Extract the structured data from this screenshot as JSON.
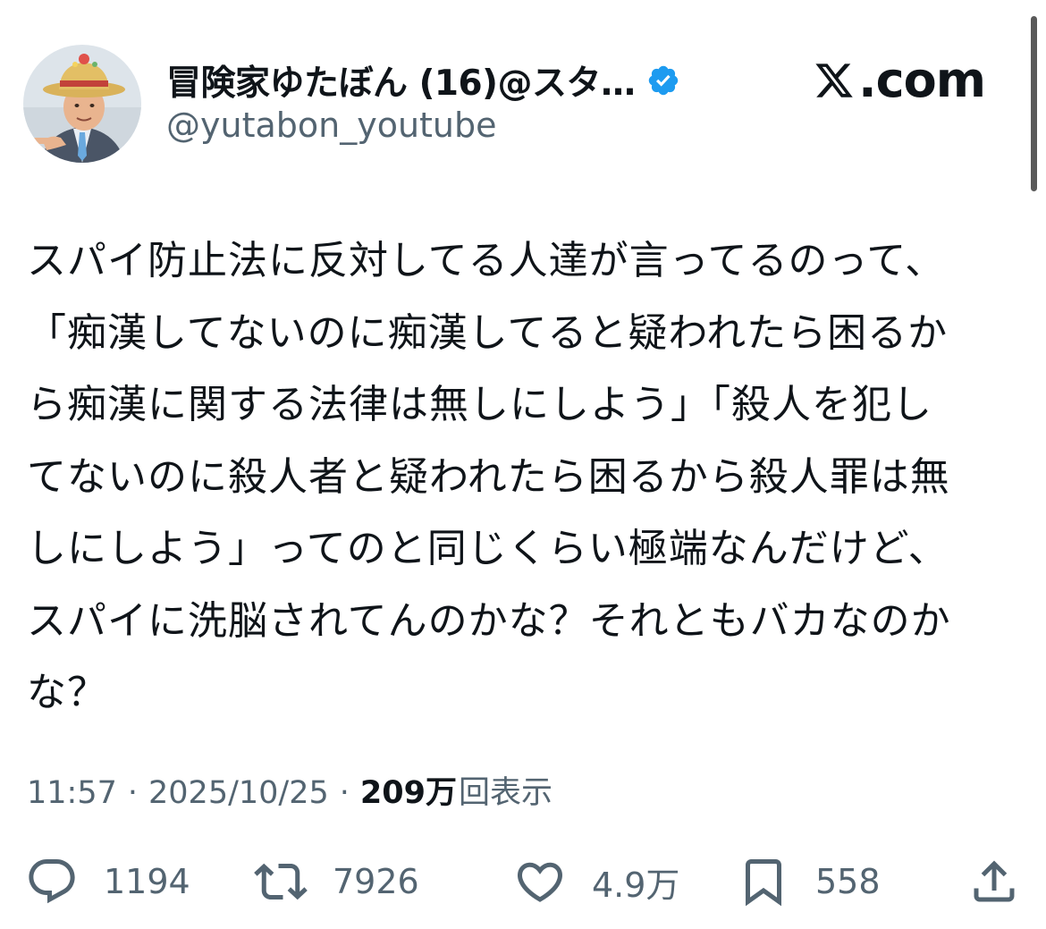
{
  "header": {
    "display_name": "冒険家ゆたぼん (16)@スタ…",
    "handle": "@yutabon_youtube",
    "site_label": ".com",
    "verified_icon": "verified-badge-icon",
    "accent_color": "#1d9bf0"
  },
  "tweet": {
    "lines": [
      "スパイ防止法に反対してる人達が言ってるのって、",
      "「痴漢してないのに痴漢してると疑われたら困るか",
      "ら痴漢に関する法律は無しにしよう」「殺人を犯し",
      "てないのに殺人者と疑われたら困るから殺人罪は無",
      "しにしよう」ってのと同じくらい極端なんだけど、",
      "スパイに洗脳されてんのかな？それともバカなのか",
      "な？"
    ]
  },
  "meta": {
    "time": "11:57",
    "separator": "·",
    "date": "2025/10/25",
    "views_count": "209万",
    "views_label": "回表示"
  },
  "actions": {
    "reply": {
      "icon": "reply-icon",
      "count": "1194"
    },
    "repost": {
      "icon": "repost-icon",
      "count": "7926"
    },
    "like": {
      "icon": "heart-icon",
      "count": "4.9万"
    },
    "bookmark": {
      "icon": "bookmark-icon",
      "count": "558"
    },
    "share": {
      "icon": "share-icon"
    }
  }
}
